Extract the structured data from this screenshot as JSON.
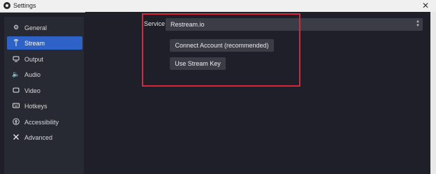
{
  "window": {
    "title": "Settings",
    "close_glyph": "✕"
  },
  "sidebar": {
    "items": [
      {
        "label": "General",
        "icon": "gear-icon",
        "active": false
      },
      {
        "label": "Stream",
        "icon": "antenna-icon",
        "active": true
      },
      {
        "label": "Output",
        "icon": "output-icon",
        "active": false
      },
      {
        "label": "Audio",
        "icon": "speaker-icon",
        "active": false
      },
      {
        "label": "Video",
        "icon": "monitor-icon",
        "active": false
      },
      {
        "label": "Hotkeys",
        "icon": "keyboard-icon",
        "active": false
      },
      {
        "label": "Accessibility",
        "icon": "accessibility-icon",
        "active": false
      },
      {
        "label": "Advanced",
        "icon": "tools-icon",
        "active": false
      }
    ]
  },
  "stream": {
    "service_label": "Service",
    "service_value": "Restream.io",
    "connect_button": "Connect Account (recommended)",
    "stream_key_button": "Use Stream Key"
  },
  "colors": {
    "accent": "#2f62c7",
    "highlight_border": "#d6273b",
    "background": "#1e1f29",
    "sidebar": "#272a33"
  }
}
